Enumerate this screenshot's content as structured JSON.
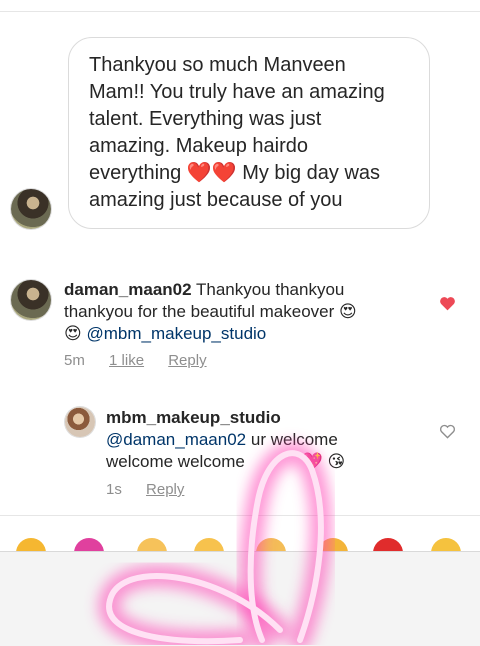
{
  "message": {
    "lines": [
      "Thankyou so much Manveen",
      "Mam!! You truly have an amazing",
      "talent. Everything was just",
      "amazing. Makeup hairdo",
      "everything",
      "My big day was",
      "amazing just because of you"
    ],
    "emojis": [
      "❤️",
      "❤️"
    ]
  },
  "comments": [
    {
      "username": "daman_maan02",
      "text_line1": "Thankyou thankyou",
      "text_line2": "thankyou for the beautiful makeover",
      "mention": "@mbm_makeup_studio",
      "time": "5m",
      "likes": "1 like",
      "reply": "Reply",
      "liked": true
    },
    {
      "username": "mbm_makeup_studio",
      "mention": "@daman_maan02",
      "text_line1": "ur welcome",
      "text_line2": "welcome welcome",
      "time": "1s",
      "reply": "Reply",
      "liked": false
    }
  ],
  "colors": {
    "like_red": "#ed4956",
    "mention_blue": "#003569",
    "neon_pink": "#ff4fbf"
  },
  "icons": [
    "heart-filled-icon",
    "heart-outline-icon"
  ]
}
